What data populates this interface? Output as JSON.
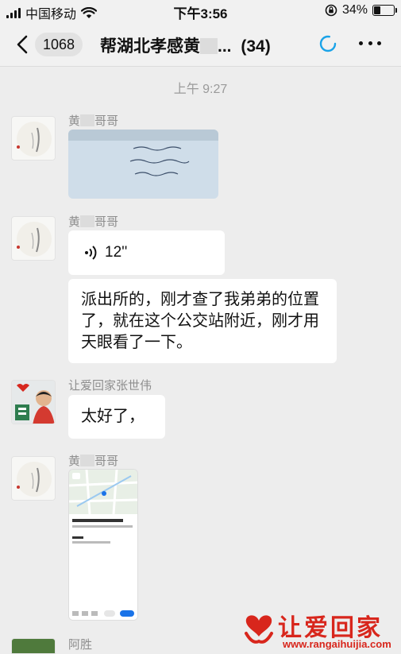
{
  "status_bar": {
    "carrier": "中国移动",
    "time": "下午3:56",
    "battery": "34%",
    "battery_level": 0.34
  },
  "nav": {
    "unread_count": "1068",
    "title": "帮湖北孝感黄",
    "title_ellipsis": "...",
    "member_count": "(34)"
  },
  "timestamp": "上午 9:27",
  "messages": [
    {
      "sender_prefix": "黄",
      "sender_suffix": "哥哥",
      "type": "image"
    },
    {
      "sender_prefix": "黄",
      "sender_suffix": "哥哥",
      "type": "voice",
      "duration": "12''"
    },
    {
      "type": "text",
      "text": "派出所的，刚才查了我弟弟的位置了，就在这个公交站附近，刚才用天眼看了一下。"
    },
    {
      "sender": "让爱回家张世伟",
      "type": "text",
      "text": "太好了，"
    },
    {
      "sender_prefix": "黄",
      "sender_suffix": "哥哥",
      "type": "map_screenshot"
    },
    {
      "sender": "阿胜",
      "type": "partial"
    }
  ],
  "watermark": {
    "title": "让爱回家",
    "url": "www.rangaihuijia.com"
  },
  "colors": {
    "background": "#ededed",
    "bubble": "#ffffff",
    "accent_blue": "#1aa3e8",
    "brand_red": "#d8261c"
  }
}
